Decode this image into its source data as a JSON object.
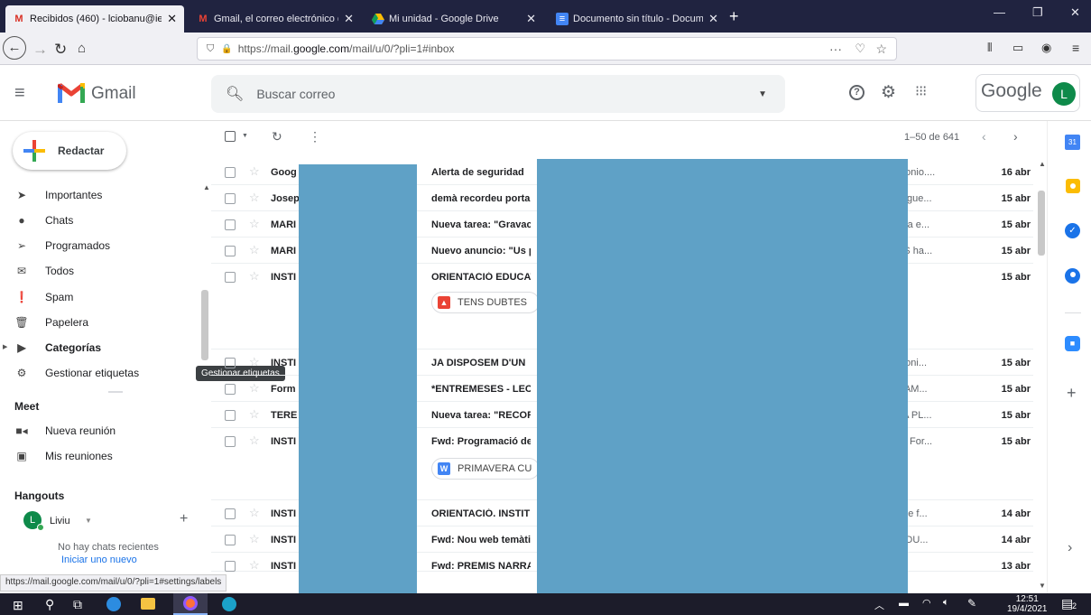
{
  "browser": {
    "tabs": [
      {
        "title": "Recibidos (460) - lciobanu@ies",
        "active": true
      },
      {
        "title": "Gmail, el correo electrónico de",
        "active": false
      },
      {
        "title": "Mi unidad - Google Drive",
        "active": false
      },
      {
        "title": "Documento sin título - Docum",
        "active": false
      }
    ],
    "url_prefix": "https://mail.",
    "url_domain": "google.com",
    "url_path": "/mail/u/0/?pli=1#inbox",
    "status_url": "https://mail.google.com/mail/u/0/?pli=1#settings/labels"
  },
  "gmail": {
    "logo_text": "Gmail",
    "search_placeholder": "Buscar correo",
    "google_label": "Google",
    "avatar_letter": "L",
    "compose_label": "Redactar",
    "pagination": "1–50 de 641",
    "tooltip": "Gestionar etiquetas"
  },
  "sidebar": {
    "items": [
      {
        "label": "Importantes",
        "icon": "importance-icon"
      },
      {
        "label": "Chats",
        "icon": "chat-icon"
      },
      {
        "label": "Programados",
        "icon": "scheduled-icon"
      },
      {
        "label": "Todos",
        "icon": "mail-icon"
      },
      {
        "label": "Spam",
        "icon": "spam-icon"
      },
      {
        "label": "Papelera",
        "icon": "trash-icon"
      },
      {
        "label": "Categorías",
        "icon": "label-icon"
      },
      {
        "label": "Gestionar etiquetas",
        "icon": "gear-icon"
      }
    ],
    "meet_title": "Meet",
    "meet_items": [
      {
        "label": "Nueva reunión"
      },
      {
        "label": "Mis reuniones"
      }
    ],
    "hangouts_title": "Hangouts",
    "hangouts_user": "Liviu",
    "no_chats": "No hay chats recientes",
    "start_new": "Iniciar uno nuevo"
  },
  "emails": [
    {
      "sender": "Goog",
      "subject": "Alerta de seguridad",
      "tail": "ntonio....",
      "date": "16 abr"
    },
    {
      "sender": "Josep",
      "subject": "demà recordeu porta",
      "tail": "stigue...",
      "date": "15 abr"
    },
    {
      "sender": "MARI",
      "subject": "Nueva tarea: \"Gravac",
      "tail": "eva e...",
      "date": "15 abr"
    },
    {
      "sender": "MARI",
      "subject": "Nuevo anuncio: \"Us p",
      "tail": "AS ha...",
      "date": "15 abr"
    },
    {
      "sender": "INSTI",
      "subject": "ORIENTACIÓ EDUCAT",
      "tail": "",
      "date": "15 abr",
      "chip": "TENS DUBTES"
    },
    {
      "sender": "INSTI",
      "subject": "JA DISPOSEM D'UN",
      "tail": "ntoni...",
      "date": "15 abr"
    },
    {
      "sender": "Form",
      "subject": "*ENTREMESES - LEC",
      "tail": "RAM...",
      "date": "15 abr"
    },
    {
      "sender": "TERE",
      "subject": "Nueva tarea: \"RECOR",
      "tail": "LA PL...",
      "date": "15 abr"
    },
    {
      "sender": "INSTI",
      "subject": "Fwd: Programació de",
      "tail": "— For...",
      "date": "15 abr",
      "chip": "PRIMAVERA CU"
    },
    {
      "sender": "INSTI",
      "subject": "ORIENTACIÓ. INSTIT",
      "tail": "que f...",
      "date": "14 abr"
    },
    {
      "sender": "INSTI",
      "subject": "Fwd: Nou web temàti",
      "tail": "'EDU...",
      "date": "14 abr"
    },
    {
      "sender": "INSTI",
      "subject": "Fwd: PREMIS NARRA",
      "tail": "",
      "date": "13 abr"
    }
  ],
  "taskbar": {
    "time": "12:51",
    "date": "19/4/2021",
    "notif_count": "2"
  }
}
